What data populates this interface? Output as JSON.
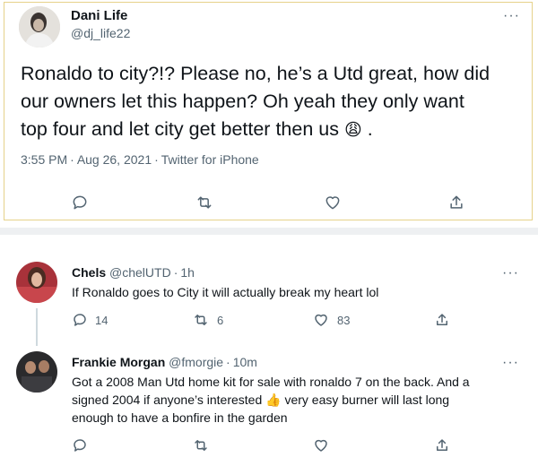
{
  "main_tweet": {
    "name": "Dani Life",
    "handle": "@dj_life22",
    "text_lines": [
      "Ronaldo to city?!? Please no, he’s a Utd great, how did",
      "our owners let this happen? Oh yeah they only want",
      "top four and let city get better then us"
    ],
    "text_end": ".",
    "emoji": "😩",
    "time": "3:55 PM",
    "date": "Aug 26, 2021",
    "source": "Twitter for iPhone",
    "dot": "·"
  },
  "reply1": {
    "name": "Chels",
    "handle": "@chelUTD",
    "time": "1h",
    "text": "If Ronaldo goes to City it will actually break my heart lol",
    "reply_count": "14",
    "retweet_count": "6",
    "like_count": "83"
  },
  "reply2": {
    "name": "Frankie Morgan",
    "handle": "@fmorgie",
    "time": "10m",
    "text_line1": "Got a 2008 Man Utd home kit for sale with ronaldo 7 on the back. And a",
    "text_line2a": "signed 2004 if anyone’s interested",
    "emoji": "👍",
    "text_line2b": "very easy burner will last long",
    "text_line3": "enough to have a bonfire in the garden"
  },
  "more_label": "···",
  "icons": [
    "reply-icon",
    "retweet-icon",
    "like-icon",
    "share-icon"
  ],
  "colors": {
    "highlight_border": "#e6d28a",
    "secondary_text": "#536471",
    "divider": "#eef0f2"
  }
}
